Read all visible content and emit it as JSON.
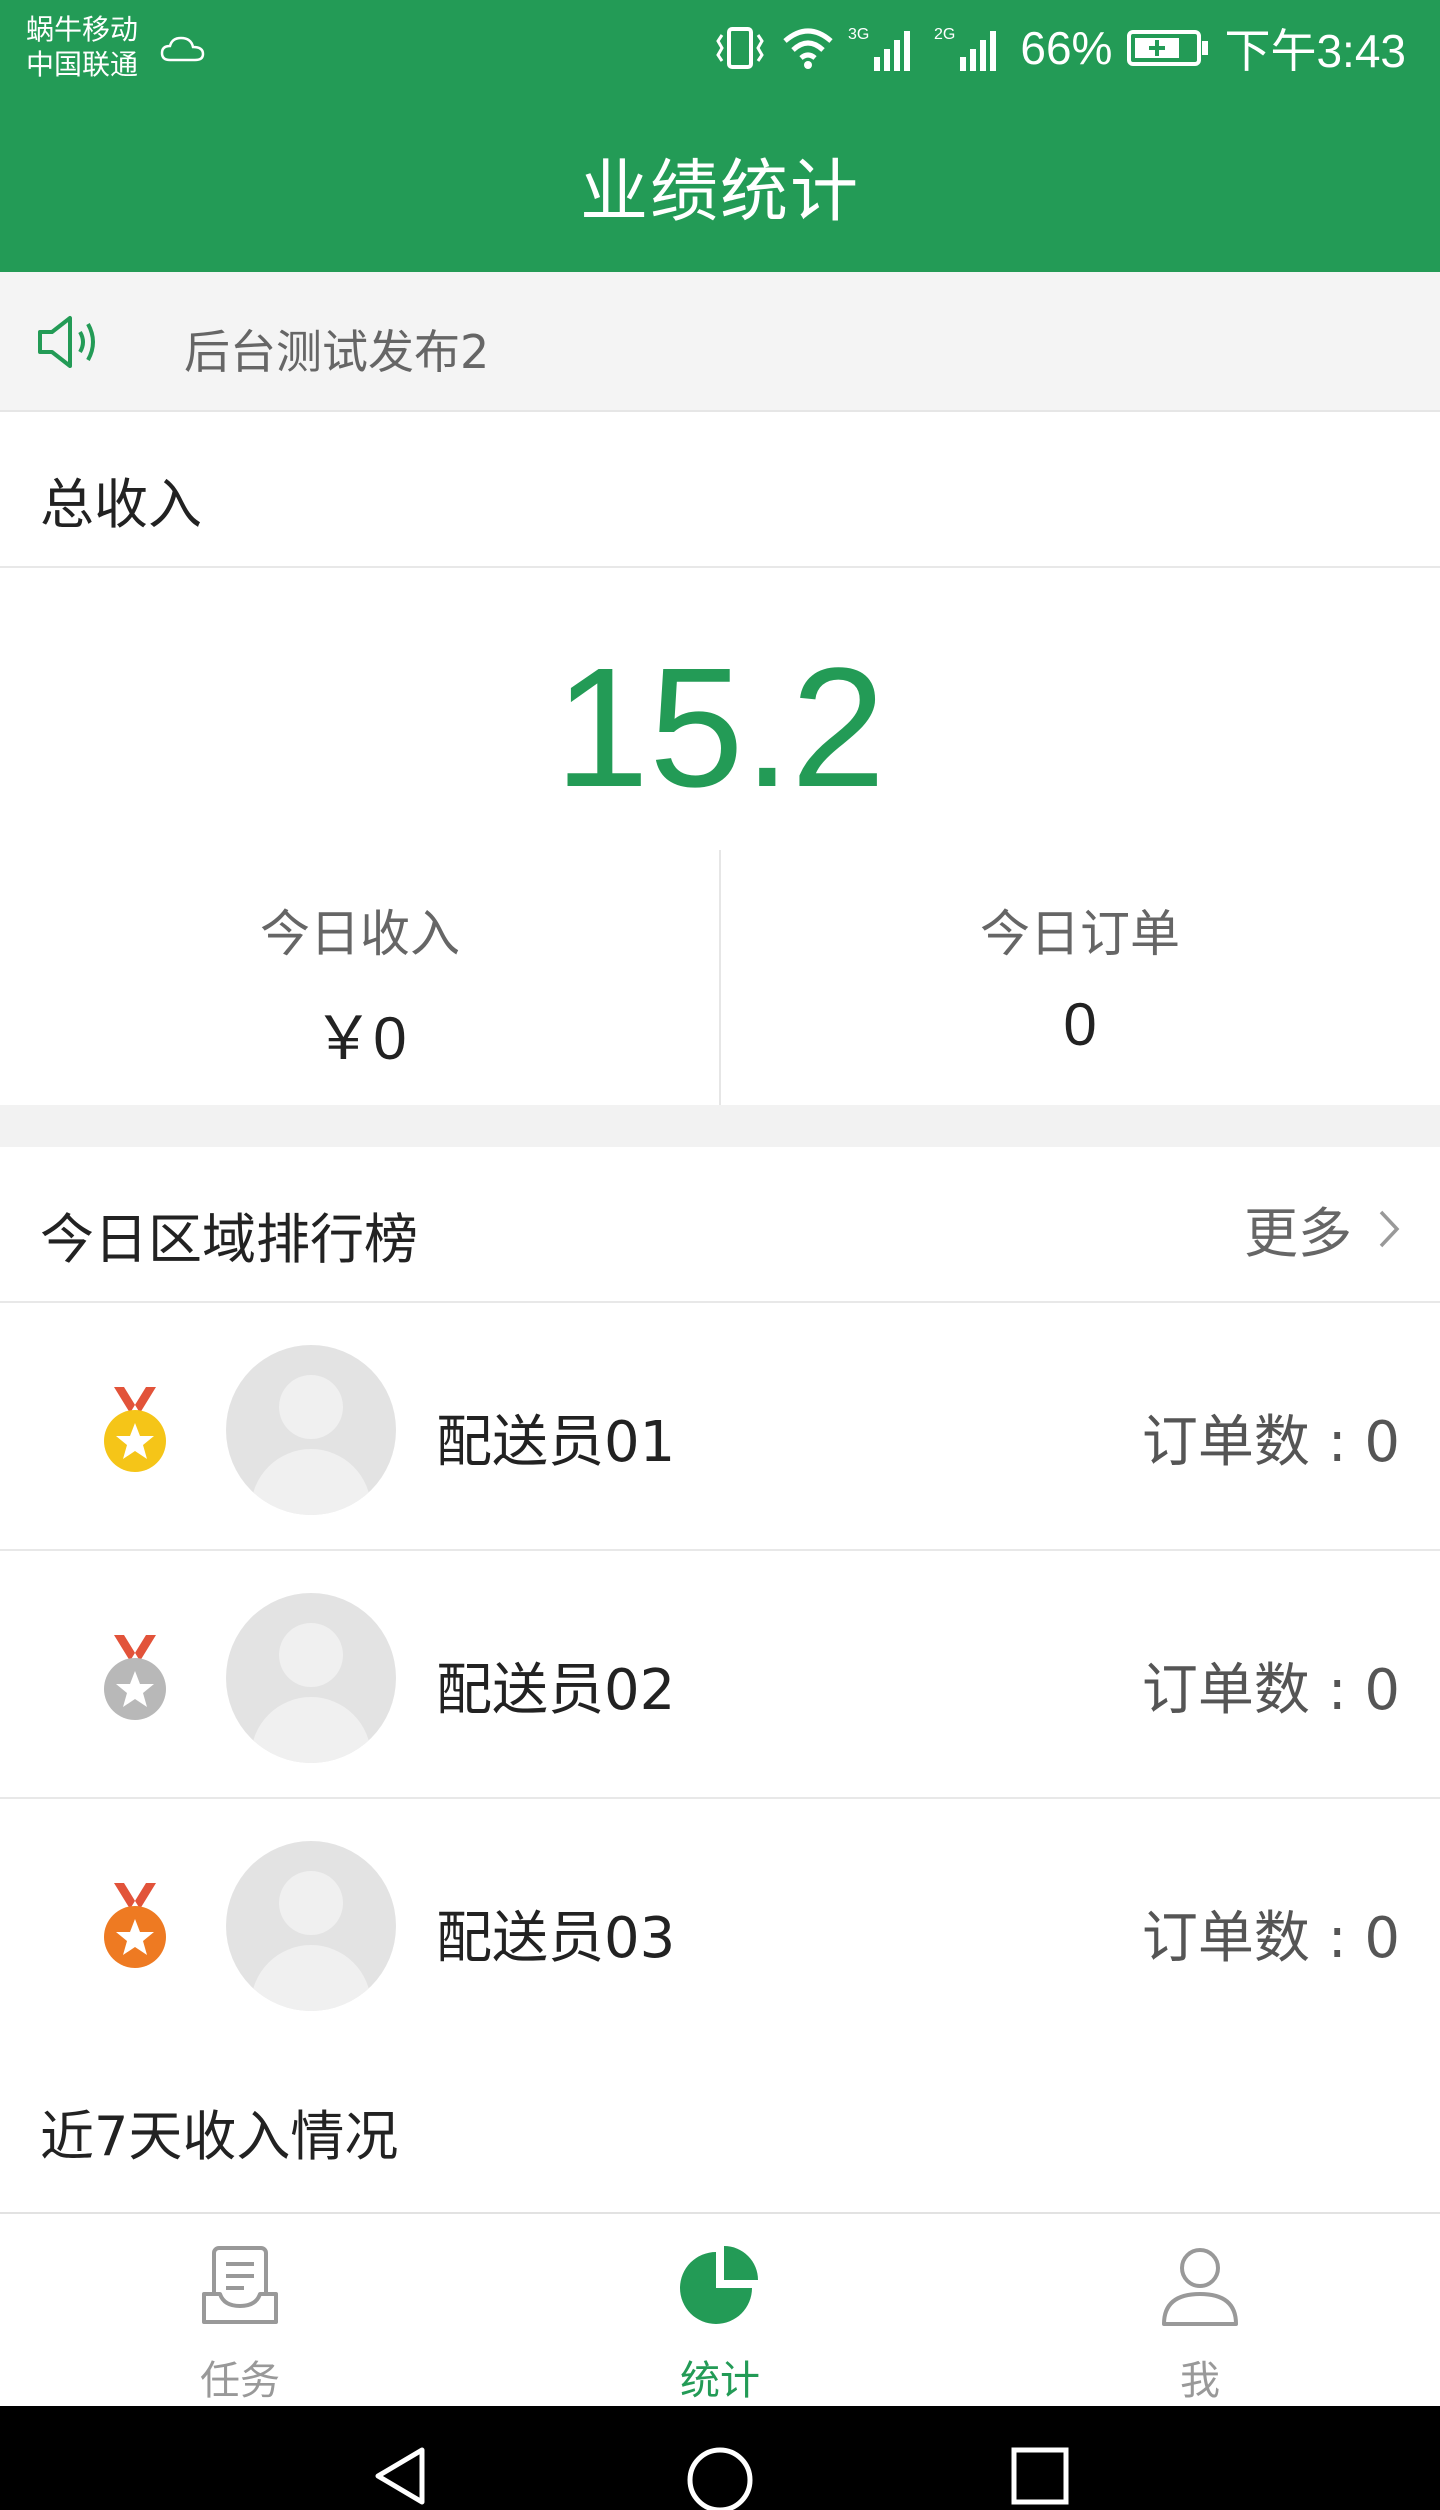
{
  "status_bar": {
    "carrier_1": "蜗牛移动",
    "carrier_2": "中国联通",
    "signal_1": "3G",
    "signal_2": "2G",
    "battery": "66%",
    "time": "下午3:43"
  },
  "header": {
    "title": "业绩统计"
  },
  "notice": {
    "text": "后台测试发布2",
    "icon": "speaker-icon"
  },
  "income": {
    "title": "总收入",
    "total": "15.2",
    "today_income_label": "今日收入",
    "today_income_value": "￥0",
    "today_orders_label": "今日订单",
    "today_orders_value": "0"
  },
  "ranking": {
    "title": "今日区域排行榜",
    "more_label": "更多",
    "rows": [
      {
        "name": "配送员01",
        "orders": "订单数 : 0",
        "medal": "gold"
      },
      {
        "name": "配送员02",
        "orders": "订单数 : 0",
        "medal": "silver"
      },
      {
        "name": "配送员03",
        "orders": "订单数 : 0",
        "medal": "bronze"
      }
    ]
  },
  "week": {
    "title": "近7天收入情况"
  },
  "tabbar": {
    "tabs": [
      {
        "label": "任务",
        "icon": "task-icon",
        "active": false
      },
      {
        "label": "统计",
        "icon": "pie-chart-icon",
        "active": true
      },
      {
        "label": "我",
        "icon": "user-icon",
        "active": false
      }
    ]
  },
  "colors": {
    "accent": "#239b56",
    "gold": "#f5c518",
    "silver": "#b8b8b8",
    "bronze": "#ee7a22",
    "ribbon": "#e2533a"
  }
}
